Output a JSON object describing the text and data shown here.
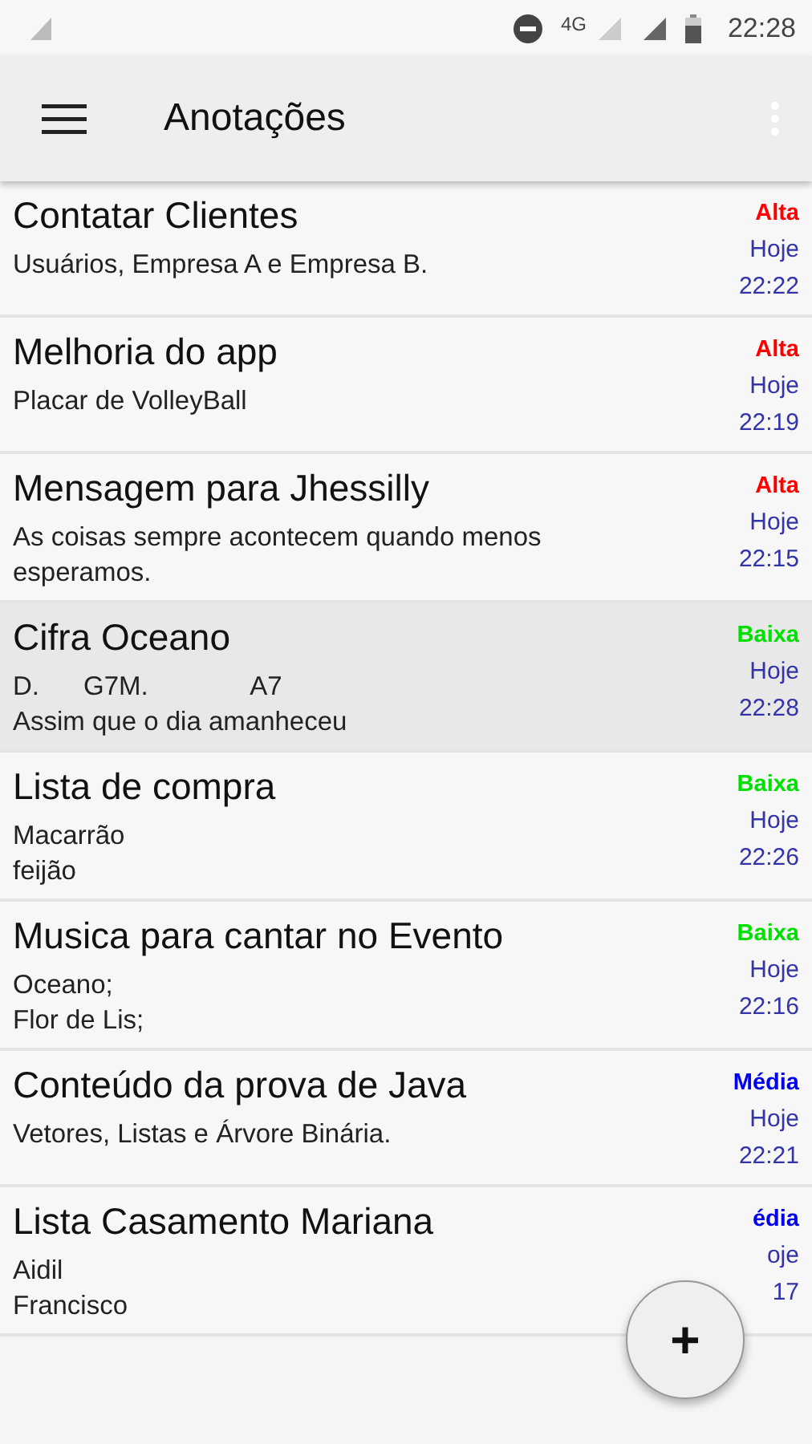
{
  "status_bar": {
    "time": "22:28",
    "network": "4G"
  },
  "toolbar": {
    "title": "Anotações"
  },
  "notes": [
    {
      "title": "Contatar Clientes",
      "lines": [
        "Usuários, Empresa A e Empresa B."
      ],
      "priority": "Alta",
      "color": "#ff0000",
      "day": "Hoje",
      "time": "22:22",
      "selected": false
    },
    {
      "title": "Melhoria do app",
      "lines": [
        "Placar de VolleyBall"
      ],
      "priority": "Alta",
      "color": "#ff0000",
      "day": "Hoje",
      "time": "22:19",
      "selected": false
    },
    {
      "title": "Mensagem para Jhessilly",
      "lines": [
        "As coisas sempre acontecem quando menos esperamos."
      ],
      "priority": "Alta",
      "color": "#ff0000",
      "day": "Hoje",
      "time": "22:15",
      "selected": false
    },
    {
      "title": "Cifra Oceano",
      "lines": [
        "D.      G7M.              A7",
        "Assim que o dia amanheceu"
      ],
      "priority": "Baixa",
      "color": "#00e000",
      "day": "Hoje",
      "time": "22:28",
      "selected": true
    },
    {
      "title": "Lista de compra",
      "lines": [
        "Macarrão",
        "feijão"
      ],
      "priority": "Baixa",
      "color": "#00e000",
      "day": "Hoje",
      "time": "22:26",
      "selected": false
    },
    {
      "title": "Musica para cantar no Evento",
      "lines": [
        "Oceano;",
        "Flor de Lis;"
      ],
      "priority": "Baixa",
      "color": "#00e000",
      "day": "Hoje",
      "time": "22:16",
      "selected": false
    },
    {
      "title": "Conteúdo da prova de Java",
      "lines": [
        "Vetores, Listas e Árvore Binária."
      ],
      "priority": "Média",
      "color": "#0000ee",
      "day": "Hoje",
      "time": "22:21",
      "selected": false
    },
    {
      "title": "Lista Casamento Mariana",
      "lines": [
        "Aidil",
        "Francisco"
      ],
      "priority": "édia",
      "color": "#0000ee",
      "day": "oje",
      "time": "17",
      "selected": false
    }
  ],
  "fab": {
    "label": "+"
  }
}
